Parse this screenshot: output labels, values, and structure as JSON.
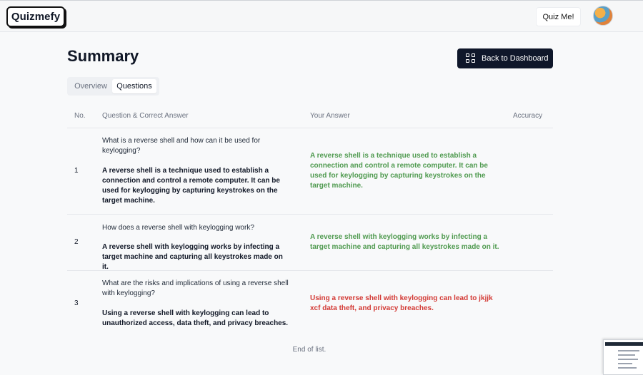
{
  "header": {
    "logo": "Quizmefy",
    "quiz_button": "Quiz Me!"
  },
  "page": {
    "title": "Summary",
    "back_button": "Back to Dashboard",
    "tabs": [
      "Overview",
      "Questions"
    ],
    "active_tab": "Questions"
  },
  "table": {
    "columns": [
      "No.",
      "Question & Correct Answer",
      "Your Answer",
      "Accuracy"
    ],
    "rows": [
      {
        "no": "1",
        "question": "What is a reverse shell and how can it be used for keylogging?",
        "correct_answer": "A reverse shell is a technique used to establish a connection and control a remote computer. It can be used for keylogging by capturing keystrokes on the target machine.",
        "your_answer": "A reverse shell is a technique used to establish a connection and control a remote computer. It can be used for keylogging by capturing keystrokes on the target machine.",
        "status": "correct"
      },
      {
        "no": "2",
        "question": "How does a reverse shell with keylogging work?",
        "correct_answer": "A reverse shell with keylogging works by infecting a target machine and capturing all keystrokes made on it.",
        "your_answer": "A reverse shell with keylogging works by infecting a target machine and capturing all keystrokes made on it.",
        "status": "correct"
      },
      {
        "no": "3",
        "question": "What are the risks and implications of using a reverse shell with keylogging?",
        "correct_answer": "Using a reverse shell with keylogging can lead to unauthorized access, data theft, and privacy breaches.",
        "your_answer": "Using a reverse shell with keylogging can lead to jkjjk xcf data theft, and privacy breaches.",
        "status": "wrong"
      }
    ],
    "end_text": "End of list."
  },
  "colors": {
    "correct": "#4f9a4f",
    "wrong": "#d33a35",
    "primary_button": "#0f172a"
  }
}
